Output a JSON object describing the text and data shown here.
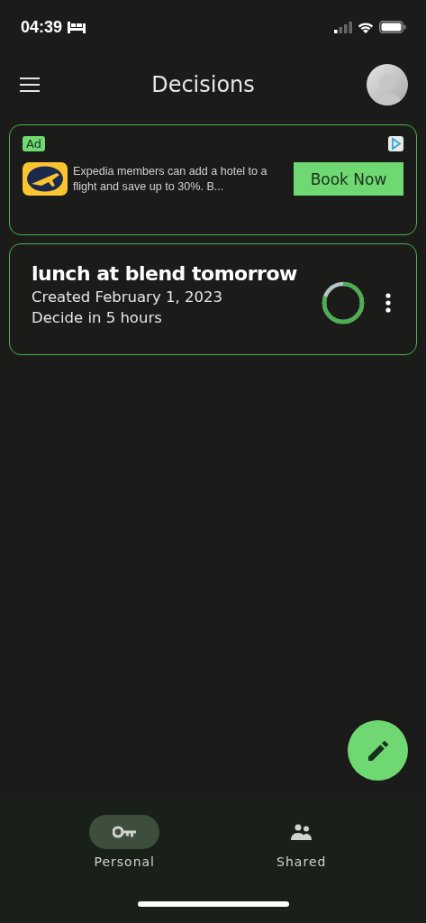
{
  "status_bar": {
    "time": "04:39"
  },
  "header": {
    "title": "Decisions"
  },
  "ad": {
    "badge": "Ad",
    "text": "Expedia members can add a hotel to a flight and save up to 30%. B...",
    "button": "Book Now"
  },
  "decisions": [
    {
      "title": "lunch at blend tomorrow",
      "created": "Created February 1, 2023",
      "deadline": "Decide in 5 hours",
      "level": 0.8
    }
  ],
  "tabs": [
    {
      "label": "Personal",
      "kind": "key",
      "selected": true
    },
    {
      "label": "Shared",
      "kind": "people",
      "selected": false
    }
  ]
}
